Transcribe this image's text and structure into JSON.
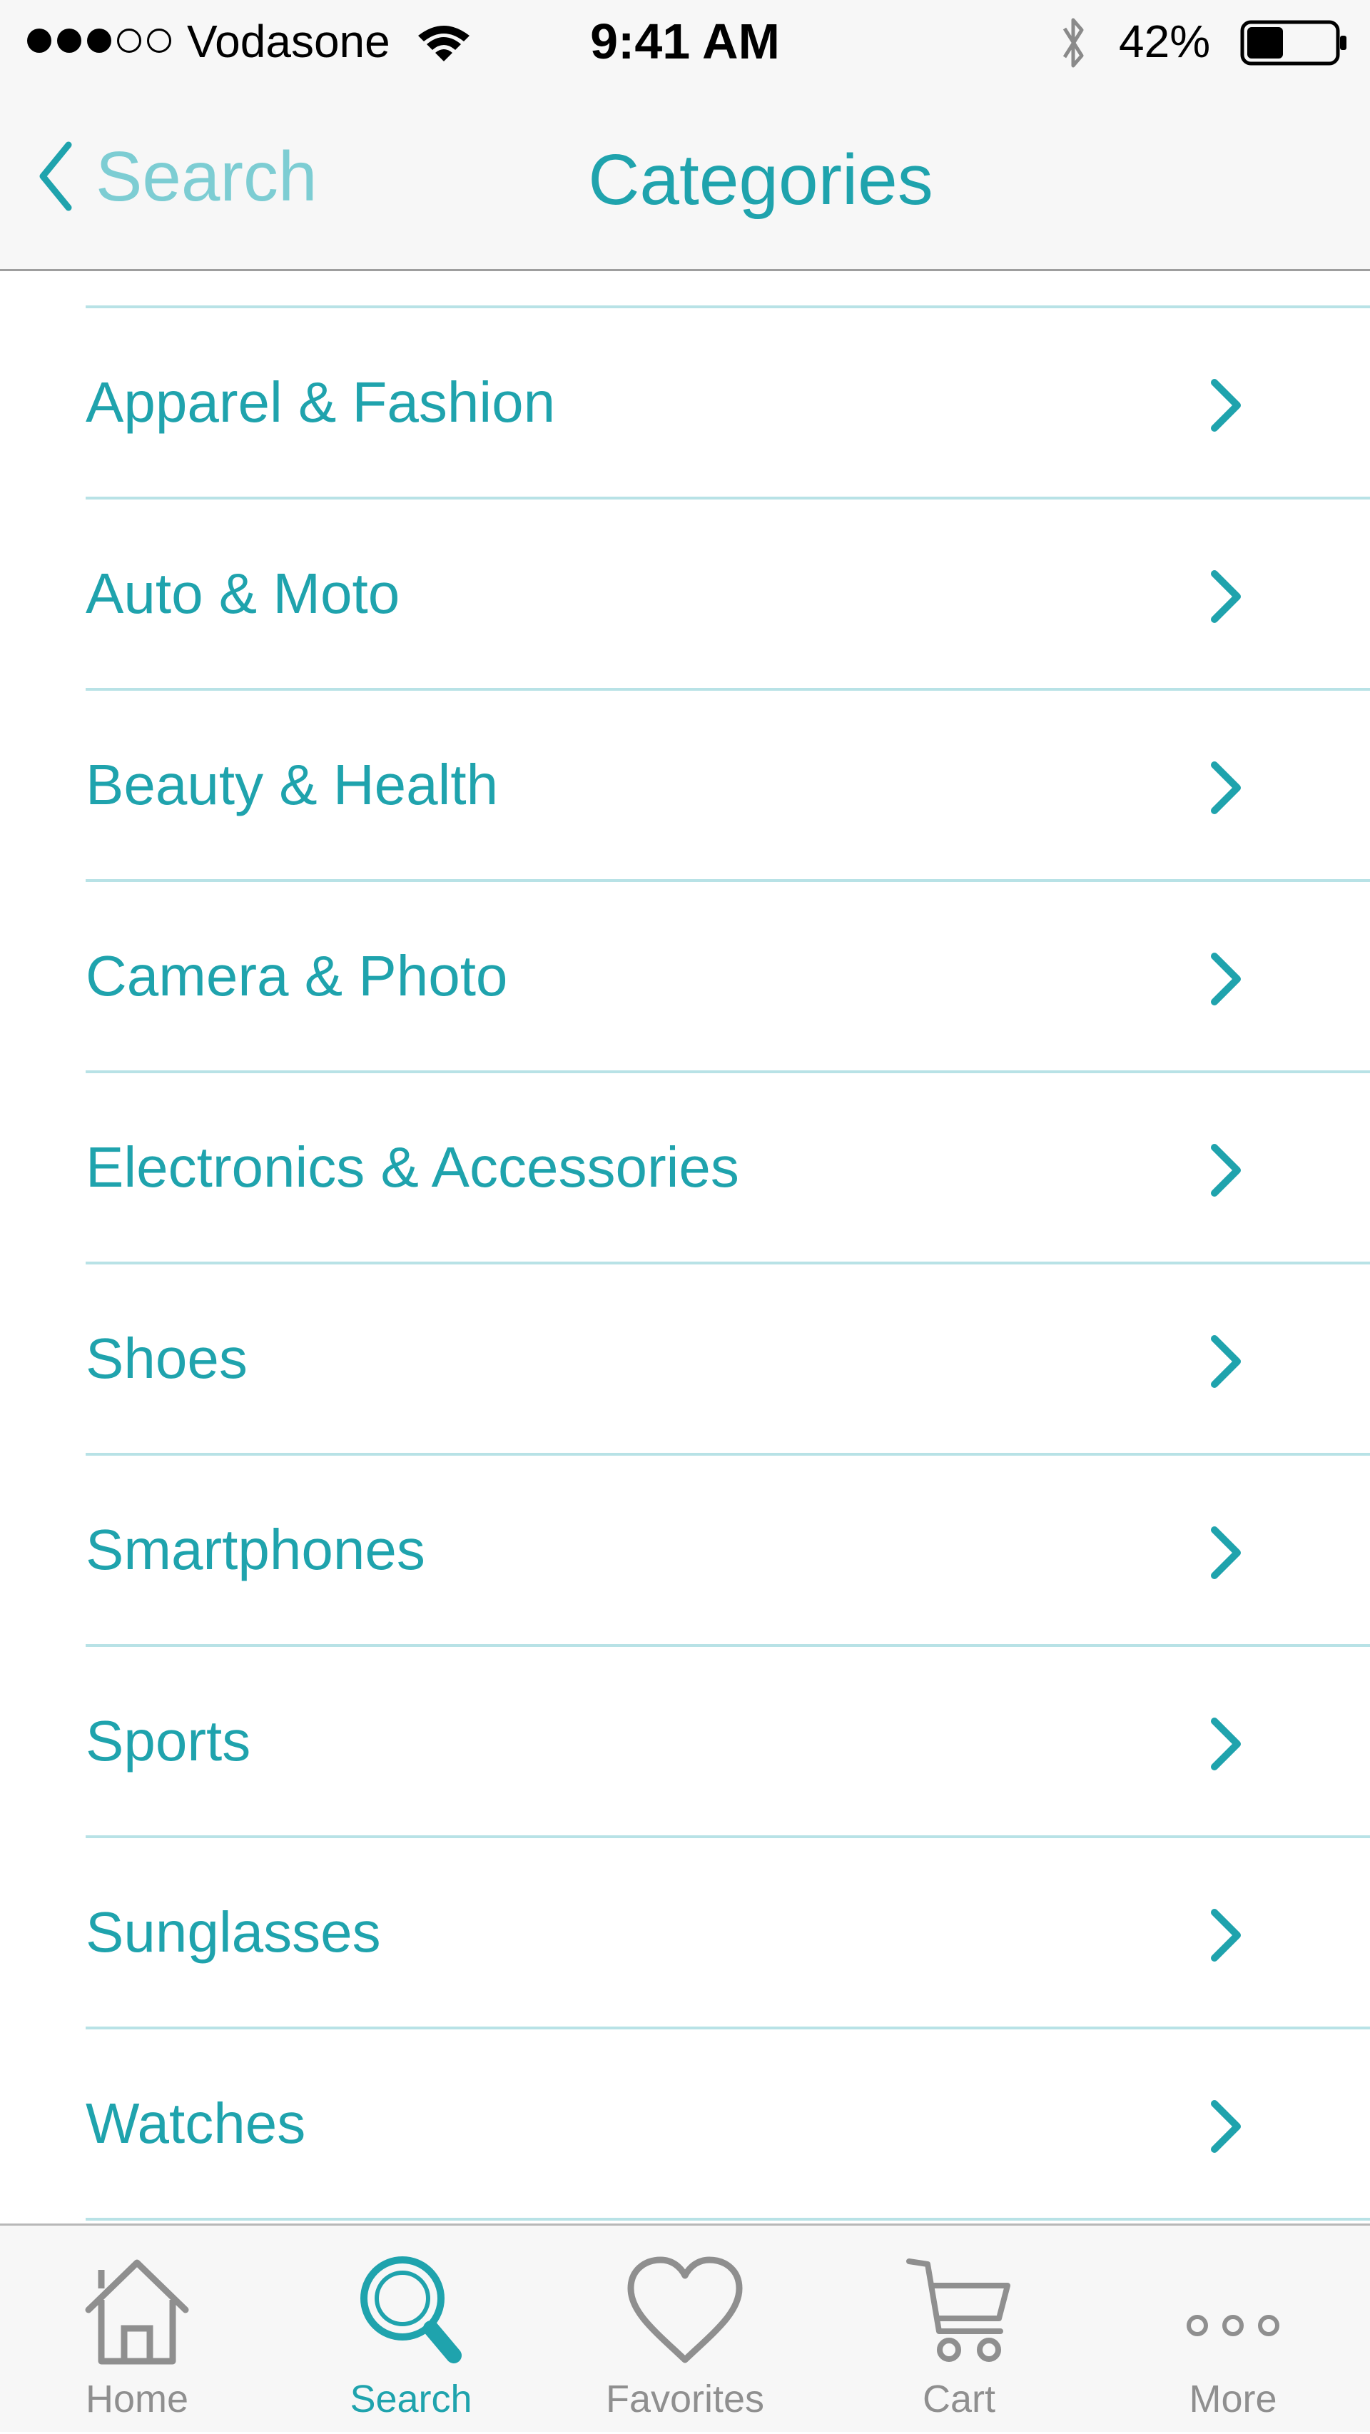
{
  "status_bar": {
    "carrier": "Vodasone",
    "time": "9:41 AM",
    "battery_percent": "42%",
    "signal_bars_filled": 3,
    "signal_bars_total": 5,
    "battery_level": 0.42
  },
  "nav": {
    "back_label": "Search",
    "title": "Categories"
  },
  "categories": [
    {
      "label": "Apparel & Fashion"
    },
    {
      "label": "Auto & Moto"
    },
    {
      "label": "Beauty & Health"
    },
    {
      "label": "Camera & Photo"
    },
    {
      "label": "Electronics & Accessories"
    },
    {
      "label": "Shoes"
    },
    {
      "label": "Smartphones"
    },
    {
      "label": "Sports"
    },
    {
      "label": "Sunglasses"
    },
    {
      "label": "Watches"
    }
  ],
  "tab_bar": {
    "tabs": [
      {
        "label": "Home",
        "icon": "home-icon"
      },
      {
        "label": "Search",
        "icon": "search-icon",
        "active": true
      },
      {
        "label": "Favorites",
        "icon": "heart-icon"
      },
      {
        "label": "Cart",
        "icon": "cart-icon"
      },
      {
        "label": "More",
        "icon": "more-icon"
      }
    ]
  },
  "colors": {
    "accent": "#1fa3ad",
    "accent_light": "#7dcdd3",
    "separator": "#b8e2e6",
    "inactive": "#8f8f8f"
  }
}
